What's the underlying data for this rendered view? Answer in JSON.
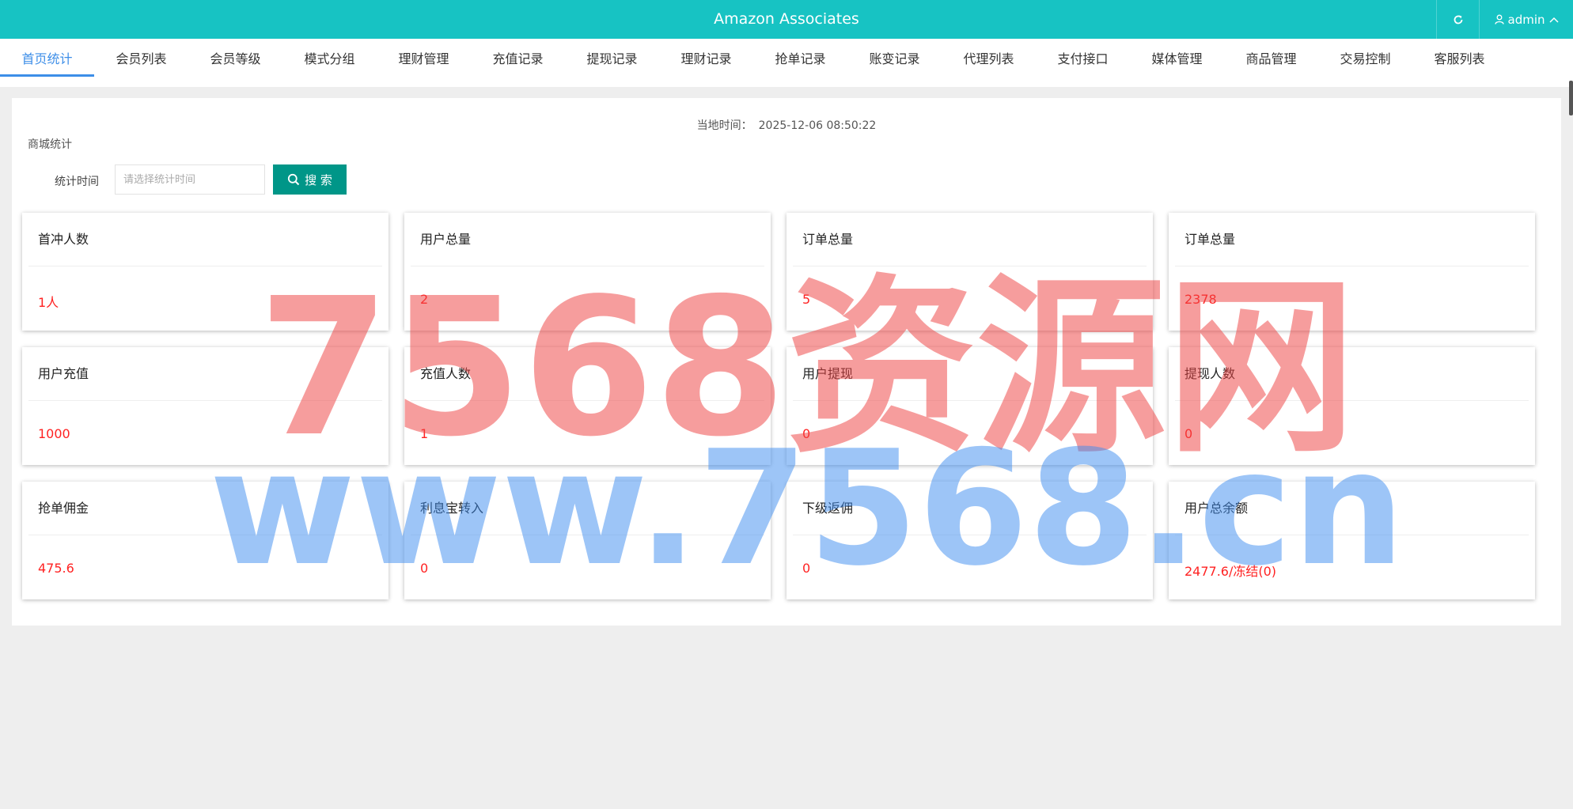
{
  "header": {
    "title": "Amazon Associates",
    "user": "admin",
    "bg_color": "#17c3c3"
  },
  "nav": {
    "items": [
      "首页统计",
      "会员列表",
      "会员等级",
      "模式分组",
      "理财管理",
      "充值记录",
      "提现记录",
      "理财记录",
      "抢单记录",
      "账变记录",
      "代理列表",
      "支付接口",
      "媒体管理",
      "商品管理",
      "交易控制",
      "客服列表"
    ],
    "active_index": 0,
    "active_color": "#3d8ee8"
  },
  "main": {
    "local_time_label": "当地时间：",
    "local_time": "2025-12-06 08:50:22",
    "section_title": "商城统计",
    "search": {
      "label": "统计时间",
      "placeholder": "请选择统计时间",
      "button": "搜 索",
      "button_color": "#009688"
    },
    "cards": [
      {
        "title": "首冲人数",
        "value": "1人"
      },
      {
        "title": "用户总量",
        "value": "2"
      },
      {
        "title": "订单总量",
        "value": "5"
      },
      {
        "title": "订单总量",
        "value": "2378"
      },
      {
        "title": "用户充值",
        "value": "1000"
      },
      {
        "title": "充值人数",
        "value": "1"
      },
      {
        "title": "用户提现",
        "value": "0"
      },
      {
        "title": "提现人数",
        "value": "0"
      },
      {
        "title": "抢单佣金",
        "value": "475.6"
      },
      {
        "title": "利息宝转入",
        "value": "0"
      },
      {
        "title": "下级返佣",
        "value": "0"
      },
      {
        "title": "用户总余额",
        "value": "2477.6/冻结(0)"
      }
    ],
    "value_color": "#ff2222"
  },
  "watermark": {
    "line1": "7568资源网",
    "line2": "www.7568.cn",
    "line1_color": "#ee4444",
    "line2_color": "#3b8cf0"
  }
}
